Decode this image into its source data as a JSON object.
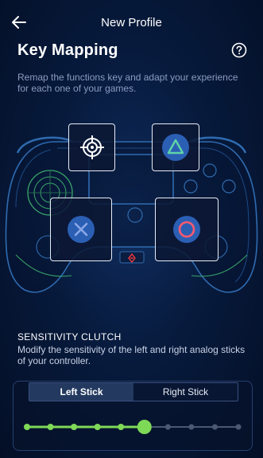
{
  "header": {
    "title": "New Profile",
    "back_icon": "arrow-left-icon",
    "help_icon": "question-circle-icon"
  },
  "key_mapping": {
    "title": "Key Mapping",
    "description": "Remap the functions key and adapt your experience for each one of your games."
  },
  "mapped_buttons": [
    {
      "icon": "crosshair-icon"
    },
    {
      "icon": "triangle-icon"
    },
    {
      "icon": "cross-icon"
    },
    {
      "icon": "circle-icon"
    }
  ],
  "sensitivity": {
    "title": "SENSITIVITY CLUTCH",
    "description": "Modify the sensitivity of the left and right analog sticks of your controller.",
    "tabs": [
      {
        "label": "Left Stick",
        "active": true
      },
      {
        "label": "Right Stick",
        "active": false
      }
    ],
    "slider": {
      "steps": 10,
      "value": 6
    }
  },
  "colors": {
    "accent_green": "#7ed957",
    "triangle_green": "#5fd3a8",
    "cross_blue": "#8aa8e8",
    "circle_red": "#ff5a6e",
    "button_fill": "#2b5fb4",
    "background": "#071a3c"
  }
}
